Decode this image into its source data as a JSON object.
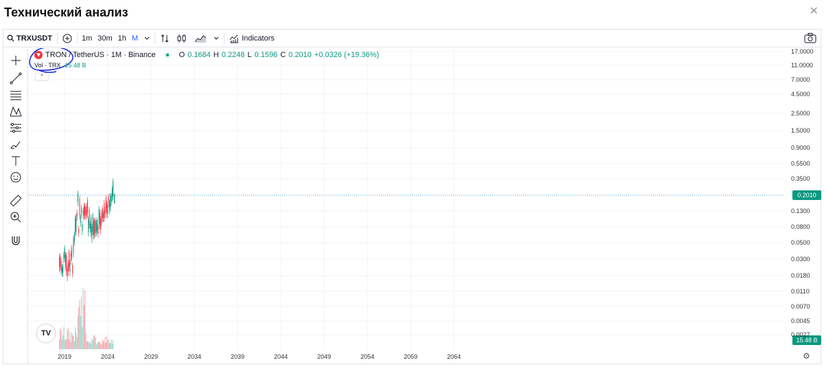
{
  "dialog": {
    "title": "Технический анализ",
    "close_icon": "✕"
  },
  "toolbar": {
    "symbol": "TRXUSDT",
    "intervals": [
      "1m",
      "30m",
      "1h",
      "M"
    ],
    "active_interval": "M",
    "indicators_label": "Indicators"
  },
  "legend": {
    "symbol_name": "TRON / TetherUS · 1M · Binance",
    "ohlc": {
      "o_label": "O",
      "o": "0.1684",
      "h_label": "H",
      "h": "0.2248",
      "l_label": "L",
      "l": "0.1596",
      "c_label": "C",
      "c": "0.2010",
      "change": "+0.0326 (+19.36%)"
    },
    "volume_label": "Vol · TRX",
    "volume_value": "15.48 B"
  },
  "price_axis": {
    "labels": [
      "17.0000",
      "11.0000",
      "7.0000",
      "4.5000",
      "2.5000",
      "1.5000",
      "0.9000",
      "0.5500",
      "0.3500",
      "0.1300",
      "0.0800",
      "0.0500",
      "0.0300",
      "0.0180",
      "0.0110",
      "0.0070",
      "0.0045",
      "0.0027"
    ],
    "current_price": "0.2010",
    "current_volume": "15.48 B"
  },
  "time_axis": {
    "labels": [
      "2019",
      "2024",
      "2029",
      "2034",
      "2039",
      "2044",
      "2049",
      "2054",
      "2059",
      "2064"
    ]
  },
  "colors": {
    "up": "#089981",
    "down": "#f23645",
    "accent": "#2962ff",
    "annotation": "#1a2fd6"
  }
}
